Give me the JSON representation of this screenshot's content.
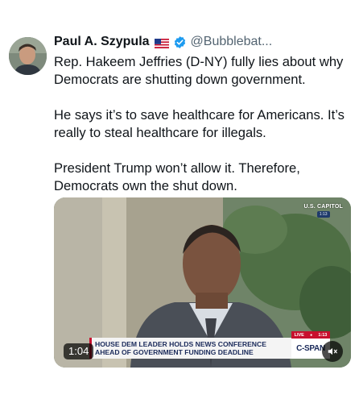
{
  "author": {
    "display_name": "Paul A. Szypula",
    "handle": "@Bubblebat...",
    "flag_icon": "us-flag-icon",
    "verified_icon": "verified-badge-icon",
    "verified_color": "#1d9bf0"
  },
  "tweet": {
    "paragraphs": [
      "Rep. Hakeem Jeffries (D-NY) fully lies about why Democrats are shutting down government.",
      "He says it’s to save healthcare for Americans. It’s really to steal healthcare for illegals.",
      "President Trump won’t allow it. Therefore, Democrats own the shut down."
    ]
  },
  "video": {
    "duration": "1:04",
    "mute_icon": "speaker-muted-icon",
    "broadcast": {
      "location_bug": "U.S. CAPITOL",
      "location_time": "1:13",
      "chyron_line1": "HOUSE DEM LEADER HOLDS NEWS CONFERENCE",
      "chyron_line2": "AHEAD OF GOVERNMENT FUNDING DEADLINE",
      "live_label": "LIVE",
      "live_time": "1:13",
      "network": "C-SPAN"
    }
  }
}
